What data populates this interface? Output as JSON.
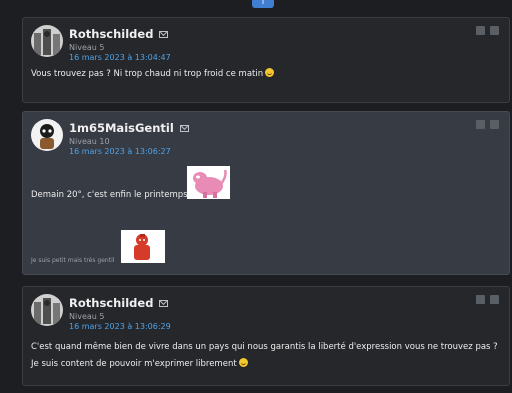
{
  "top_tab_label": "↑",
  "posts": [
    {
      "author": "Rothschilded",
      "level": "Niveau 5",
      "date": "16 mars 2023 à 13:04:47",
      "text": "Vous trouvez pas ? Ni trop chaud ni trop froid ce matin"
    },
    {
      "author": "1m65MaisGentil",
      "level": "Niveau 10",
      "date": "16 mars 2023 à 13:06:27",
      "text": "Demain 20°, c'est enfin le printemps",
      "signature": "Je suis petit mais très gentil"
    },
    {
      "author": "Rothschilded",
      "level": "Niveau 5",
      "date": "16 mars 2023 à 13:06:29",
      "text_line1": "C'est quand même bien de vivre dans un pays qui nous garantis la liberté d'expression vous ne trouvez pas ?",
      "text_line2": "Je suis content de pouvoir m'exprimer librement"
    }
  ],
  "colors": {
    "accent_blue": "#4fa3e8",
    "panel_dark": "#25272b",
    "panel_light": "#363b44"
  },
  "icons": [
    "mail-icon",
    "quote-icon",
    "more-icon",
    "smiley-icon"
  ]
}
